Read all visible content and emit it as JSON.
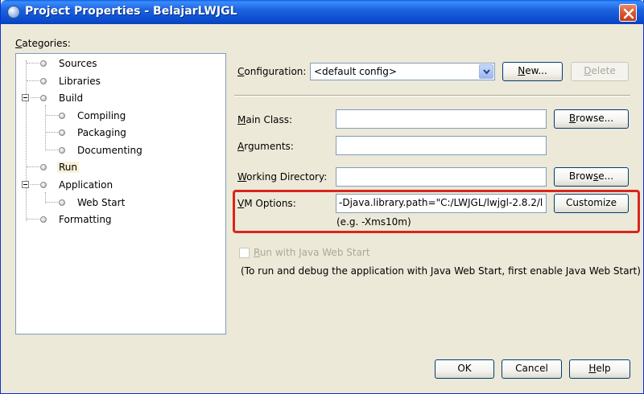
{
  "window": {
    "title": "Project Properties - BelajarLWJGL"
  },
  "categories": {
    "label_prefix": "",
    "label_accel": "C",
    "label_rest": "ategories:",
    "items": [
      {
        "label": "Sources"
      },
      {
        "label": "Libraries"
      },
      {
        "label": "Build"
      },
      {
        "label": "Compiling"
      },
      {
        "label": "Packaging"
      },
      {
        "label": "Documenting"
      },
      {
        "label": "Run"
      },
      {
        "label": "Application"
      },
      {
        "label": "Web Start"
      },
      {
        "label": "Formatting"
      }
    ],
    "selected": "Run"
  },
  "configuration": {
    "label_accel": "C",
    "label_rest": "onfiguration:",
    "value": "<default config>",
    "new_accel": "N",
    "new_rest": "ew...",
    "delete_accel": "D",
    "delete_rest": "elete"
  },
  "main_class": {
    "label_accel": "M",
    "label_rest": "ain Class:",
    "value": "",
    "browse_accel": "B",
    "browse_rest": "rowse..."
  },
  "arguments": {
    "label_accel": "A",
    "label_rest": "rguments:",
    "value": ""
  },
  "working_directory": {
    "label_accel": "W",
    "label_rest": "orking Directory:",
    "value": "",
    "browse_pre": "Brow",
    "browse_accel": "s",
    "browse_post": "e..."
  },
  "vm_options": {
    "label_accel": "V",
    "label_rest": "M Options:",
    "value": "-Djava.library.path=\"C:/LWJGL/lwjgl-2.8.2/l",
    "hint": "(e.g. -Xms10m)",
    "customize_label": "Customize"
  },
  "web_start": {
    "checkbox_accel": "R",
    "checkbox_rest": "un with Java Web Start",
    "checked": false,
    "note": "(To run and debug the application with Java Web Start, first enable Java Web Start)"
  },
  "buttons": {
    "ok": "OK",
    "cancel": "Cancel",
    "help_accel": "H",
    "help_rest": "elp"
  },
  "colors": {
    "titlebar": "#0a4ccc",
    "window_bg": "#ece9d8",
    "highlight": "#d9261c",
    "selection": "#f6f1d8"
  },
  "icons": {
    "window": "project-icon",
    "close": "close-icon",
    "tree_node": "node-bullet-icon",
    "dropdown": "chevron-down-icon"
  }
}
